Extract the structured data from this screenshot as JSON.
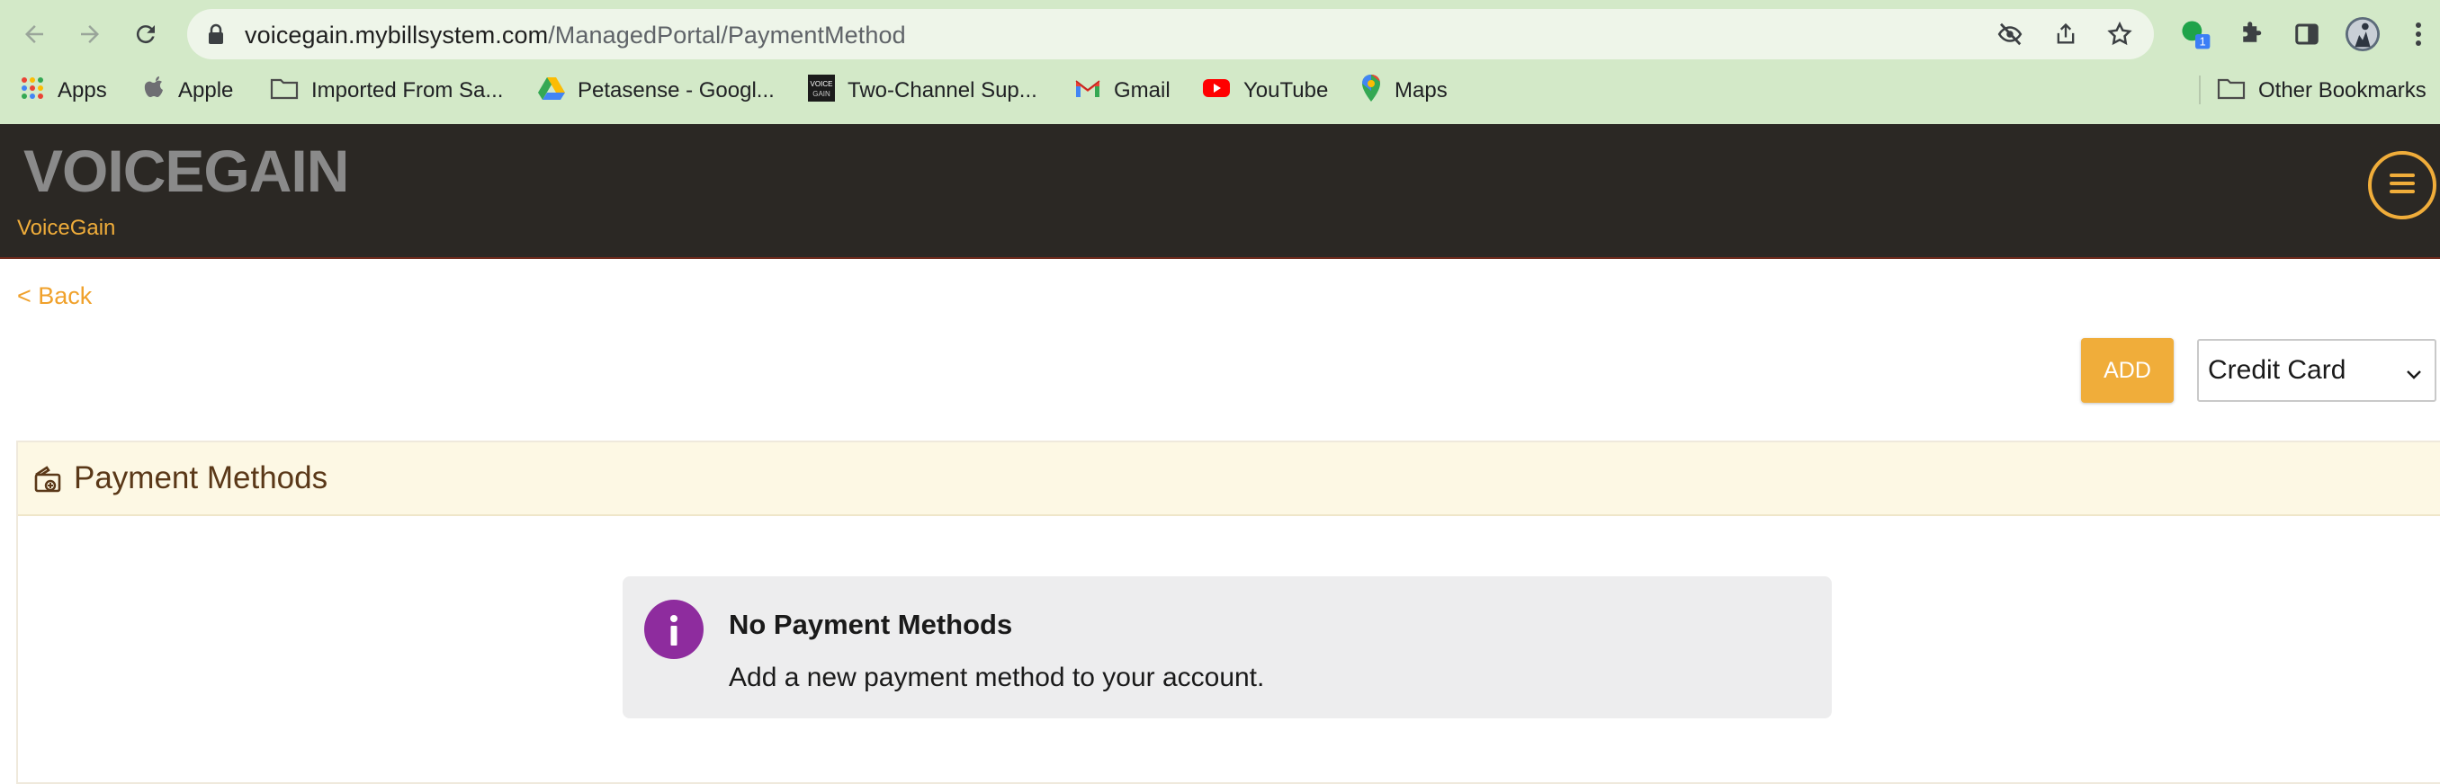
{
  "browser": {
    "url_host": "voicegain.mybillsystem.com",
    "url_path": "/ManagedPortal/PaymentMethod",
    "extension_badge": "1",
    "bookmarks": [
      {
        "label": "Apps",
        "icon": "apps-grid-icon"
      },
      {
        "label": "Apple",
        "icon": "apple-icon"
      },
      {
        "label": "Imported From Sa...",
        "icon": "folder-icon"
      },
      {
        "label": "Petasense - Googl...",
        "icon": "google-drive-icon"
      },
      {
        "label": "Two-Channel Sup...",
        "icon": "voicegain-favicon"
      },
      {
        "label": "Gmail",
        "icon": "gmail-icon"
      },
      {
        "label": "YouTube",
        "icon": "youtube-icon"
      },
      {
        "label": "Maps",
        "icon": "maps-icon"
      }
    ],
    "other_bookmarks": "Other Bookmarks"
  },
  "header": {
    "logo_text": "VOICEGAIN",
    "brand_name": "VoiceGain",
    "accent_color": "#f0ad3a",
    "background_color": "#2b2824"
  },
  "page": {
    "back_label": "< Back",
    "add_label": "ADD",
    "payment_type": "Credit Card",
    "panel_title": "Payment Methods",
    "empty_title": "No Payment Methods",
    "empty_message": "Add a new payment method to your account.",
    "info_icon_color": "#8e2c9e"
  }
}
